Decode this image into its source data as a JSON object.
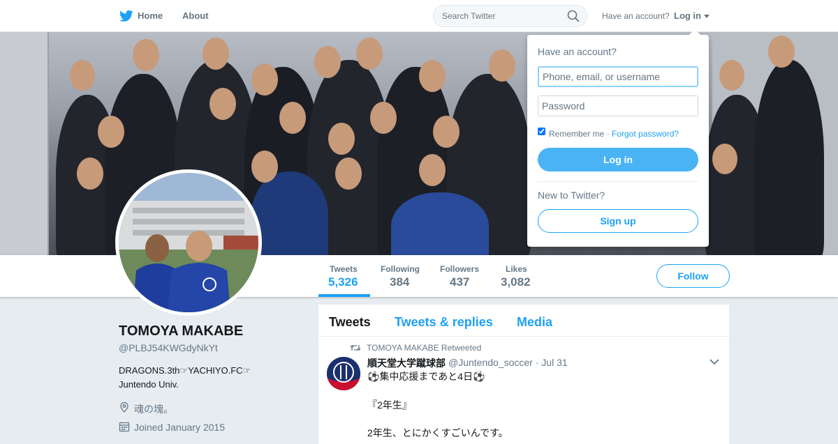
{
  "topbar": {
    "home_label": "Home",
    "about_label": "About",
    "search_placeholder": "Search Twitter",
    "have_account": "Have an account?",
    "login_label": "Log in"
  },
  "profile": {
    "name": "TOMOYA MAKABE",
    "handle": "@PLBJ54KWGdyNkYt",
    "bio": "DRAGONS.3th☞YACHIYO.FC☞ Juntendo Univ.",
    "location": "魂の塊。",
    "joined": "Joined January 2015"
  },
  "stats": [
    {
      "label": "Tweets",
      "value": "5,326",
      "active": true
    },
    {
      "label": "Following",
      "value": "384"
    },
    {
      "label": "Followers",
      "value": "437"
    },
    {
      "label": "Likes",
      "value": "3,082"
    }
  ],
  "follow_label": "Follow",
  "timeline": {
    "tabs": [
      "Tweets",
      "Tweets & replies",
      "Media"
    ],
    "tweet": {
      "retweet_label": "TOMOYA MAKABE Retweeted",
      "author_name": "順天堂大学蹴球部",
      "author_handle": "@Juntendo_soccer",
      "date": "· Jul 31",
      "lines": [
        "⚽集中応援まであと4日⚽",
        "『2年生』",
        "2年生、とにかくすごいんです。"
      ]
    }
  },
  "login_dropdown": {
    "title": "Have an account?",
    "username_placeholder": "Phone, email, or username",
    "password_placeholder": "Password",
    "remember_label": "Remember me",
    "separator": "·",
    "forgot_label": "Forgot password?",
    "login_button": "Log in",
    "new_label": "New to Twitter?",
    "signup_button": "Sign up"
  },
  "colors": {
    "accent": "#1da1f2",
    "login_button": "#4ab3f4",
    "background": "#e6ecf0"
  },
  "icons": [
    "twitter-bird-icon",
    "search-icon",
    "caret-down-icon",
    "location-pin-icon",
    "calendar-icon",
    "retweet-icon",
    "chevron-down-icon"
  ]
}
